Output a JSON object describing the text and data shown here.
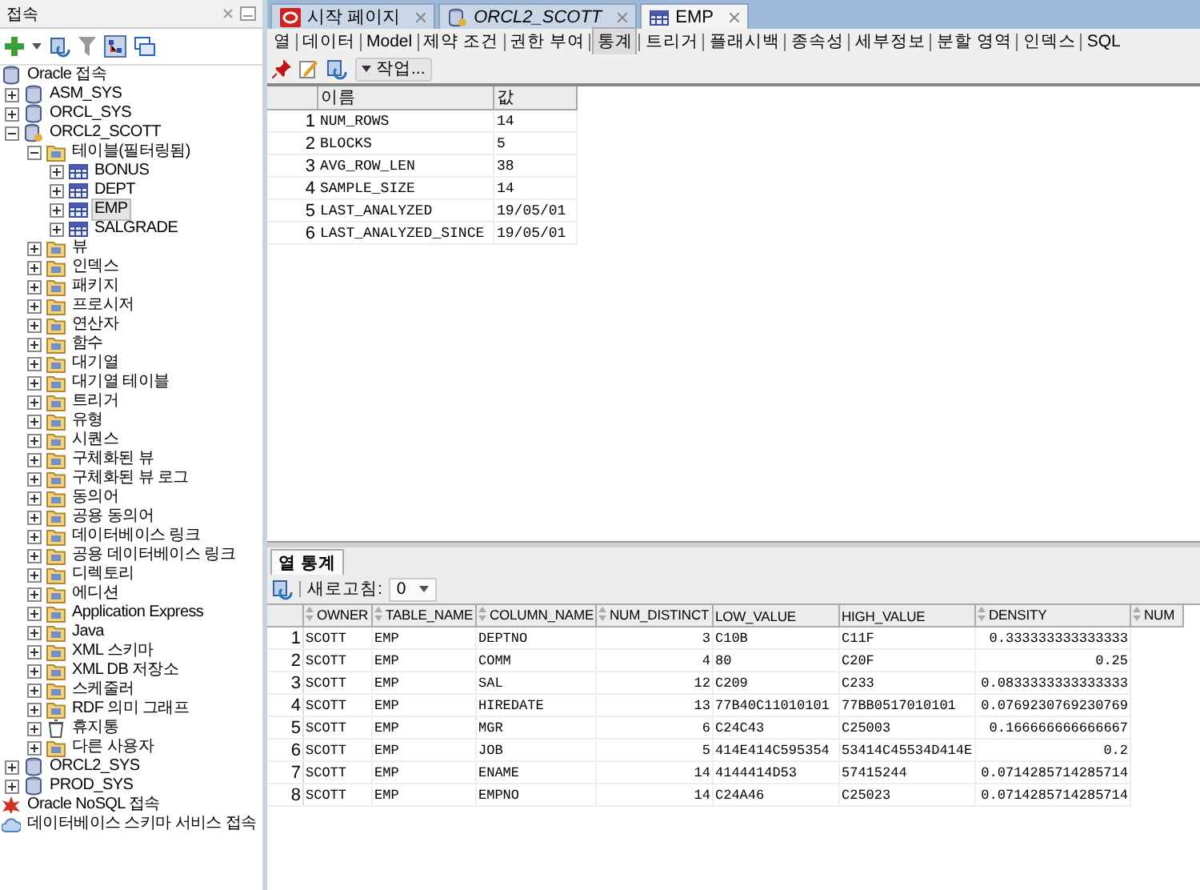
{
  "connections_panel": {
    "title": "접속",
    "tree": [
      {
        "label": "Oracle 접속",
        "kind": "connections",
        "selected": false,
        "children": [
          {
            "label": "ASM_SYS",
            "kind": "database",
            "expanded": false,
            "selected": false
          },
          {
            "label": "ORCL_SYS",
            "kind": "database",
            "expanded": false,
            "selected": false
          },
          {
            "label": "ORCL2_SCOTT",
            "kind": "database-user",
            "expanded": true,
            "selected": false,
            "children": [
              {
                "label": "테이블(필터링됨)",
                "kind": "folder",
                "expanded": true,
                "selected": false,
                "children": [
                  {
                    "label": "BONUS",
                    "kind": "table",
                    "expanded": false,
                    "selected": false
                  },
                  {
                    "label": "DEPT",
                    "kind": "table",
                    "expanded": false,
                    "selected": false
                  },
                  {
                    "label": "EMP",
                    "kind": "table",
                    "expanded": false,
                    "selected": true
                  },
                  {
                    "label": "SALGRADE",
                    "kind": "table",
                    "expanded": false,
                    "selected": false
                  }
                ]
              },
              {
                "label": "뷰",
                "kind": "folder",
                "expanded": false,
                "selected": false
              },
              {
                "label": "인덱스",
                "kind": "folder",
                "expanded": false,
                "selected": false
              },
              {
                "label": "패키지",
                "kind": "folder",
                "expanded": false,
                "selected": false
              },
              {
                "label": "프로시저",
                "kind": "folder",
                "expanded": false,
                "selected": false
              },
              {
                "label": "연산자",
                "kind": "folder",
                "expanded": false,
                "selected": false
              },
              {
                "label": "함수",
                "kind": "folder",
                "expanded": false,
                "selected": false
              },
              {
                "label": "대기열",
                "kind": "folder",
                "expanded": false,
                "selected": false
              },
              {
                "label": "대기열 테이블",
                "kind": "folder",
                "expanded": false,
                "selected": false
              },
              {
                "label": "트리거",
                "kind": "folder",
                "expanded": false,
                "selected": false
              },
              {
                "label": "유형",
                "kind": "folder",
                "expanded": false,
                "selected": false
              },
              {
                "label": "시퀀스",
                "kind": "folder",
                "expanded": false,
                "selected": false
              },
              {
                "label": "구체화된 뷰",
                "kind": "folder",
                "expanded": false,
                "selected": false
              },
              {
                "label": "구체화된 뷰 로그",
                "kind": "folder",
                "expanded": false,
                "selected": false
              },
              {
                "label": "동의어",
                "kind": "folder",
                "expanded": false,
                "selected": false
              },
              {
                "label": "공용 동의어",
                "kind": "folder",
                "expanded": false,
                "selected": false
              },
              {
                "label": "데이터베이스 링크",
                "kind": "folder",
                "expanded": false,
                "selected": false
              },
              {
                "label": "공용 데이터베이스 링크",
                "kind": "folder",
                "expanded": false,
                "selected": false
              },
              {
                "label": "디렉토리",
                "kind": "folder",
                "expanded": false,
                "selected": false
              },
              {
                "label": "에디션",
                "kind": "folder",
                "expanded": false,
                "selected": false
              },
              {
                "label": "Application Express",
                "kind": "folder",
                "expanded": false,
                "selected": false
              },
              {
                "label": "Java",
                "kind": "folder",
                "expanded": false,
                "selected": false
              },
              {
                "label": "XML 스키마",
                "kind": "folder",
                "expanded": false,
                "selected": false
              },
              {
                "label": "XML DB 저장소",
                "kind": "folder",
                "expanded": false,
                "selected": false
              },
              {
                "label": "스케줄러",
                "kind": "folder",
                "expanded": false,
                "selected": false
              },
              {
                "label": "RDF 의미 그래프",
                "kind": "folder",
                "expanded": false,
                "selected": false
              },
              {
                "label": "휴지통",
                "kind": "trash",
                "expanded": false,
                "selected": false
              },
              {
                "label": "다른 사용자",
                "kind": "folder",
                "expanded": false,
                "selected": false
              }
            ]
          },
          {
            "label": "ORCL2_SYS",
            "kind": "database",
            "expanded": false,
            "selected": false
          },
          {
            "label": "PROD_SYS",
            "kind": "database",
            "expanded": false,
            "selected": false
          }
        ]
      },
      {
        "label": "Oracle NoSQL 접속",
        "kind": "nosql",
        "selected": false
      },
      {
        "label": "데이터베이스 스키마 서비스 접속",
        "kind": "cloud",
        "selected": false
      }
    ]
  },
  "editor_tabs": [
    {
      "label": "시작 페이지",
      "kind": "start",
      "selected": false
    },
    {
      "label": "ORCL2_SCOTT",
      "kind": "connection",
      "selected": false
    },
    {
      "label": "EMP",
      "kind": "table",
      "selected": true
    }
  ],
  "sub_tabs": [
    {
      "label": "열",
      "selected": false
    },
    {
      "label": "데이터",
      "selected": false
    },
    {
      "label": "Model",
      "selected": false
    },
    {
      "label": "제약 조건",
      "selected": false
    },
    {
      "label": "권한 부여",
      "selected": false
    },
    {
      "label": "통계",
      "selected": true
    },
    {
      "label": "트리거",
      "selected": false
    },
    {
      "label": "플래시백",
      "selected": false
    },
    {
      "label": "종속성",
      "selected": false
    },
    {
      "label": "세부정보",
      "selected": false
    },
    {
      "label": "분할 영역",
      "selected": false
    },
    {
      "label": "인덱스",
      "selected": false
    },
    {
      "label": "SQL",
      "selected": false
    }
  ],
  "toolbar": {
    "actions_menu": "작업..."
  },
  "statistics_grid": {
    "columns": [
      "",
      "이름",
      "값"
    ],
    "rows": [
      [
        "1",
        "NUM_ROWS",
        "14"
      ],
      [
        "2",
        "BLOCKS",
        "5"
      ],
      [
        "3",
        "AVG_ROW_LEN",
        "38"
      ],
      [
        "4",
        "SAMPLE_SIZE",
        "14"
      ],
      [
        "5",
        "LAST_ANALYZED",
        "19/05/01"
      ],
      [
        "6",
        "LAST_ANALYZED_SINCE",
        "19/05/01"
      ]
    ]
  },
  "lower_panel": {
    "tab": {
      "label": "열 통계",
      "selected": true
    },
    "refresh_label": "새로고침:",
    "refresh_value": "0",
    "table": {
      "columns": [
        {
          "sortable": false
        },
        {
          "label": "OWNER",
          "sortable": true
        },
        {
          "label": "TABLE_NAME",
          "sortable": true
        },
        {
          "label": "COLUMN_NAME",
          "sortable": true
        },
        {
          "label": "NUM_DISTINCT",
          "sortable": true
        },
        {
          "label": "LOW_VALUE",
          "sortable": false
        },
        {
          "label": "HIGH_VALUE",
          "sortable": false
        },
        {
          "label": "DENSITY",
          "sortable": true
        },
        {
          "label": "NUM",
          "sortable": true
        }
      ],
      "rows": [
        [
          "1",
          "SCOTT",
          "EMP",
          "DEPTNO",
          "3",
          "C10B",
          "C11F",
          "0.333333333333333"
        ],
        [
          "2",
          "SCOTT",
          "EMP",
          "COMM",
          "4",
          "80",
          "C20F",
          "0.25"
        ],
        [
          "3",
          "SCOTT",
          "EMP",
          "SAL",
          "12",
          "C209",
          "C233",
          "0.0833333333333333"
        ],
        [
          "4",
          "SCOTT",
          "EMP",
          "HIREDATE",
          "13",
          "77B40C11010101",
          "77BB0517010101",
          "0.0769230769230769"
        ],
        [
          "5",
          "SCOTT",
          "EMP",
          "MGR",
          "6",
          "C24C43",
          "C25003",
          "0.166666666666667"
        ],
        [
          "6",
          "SCOTT",
          "EMP",
          "JOB",
          "5",
          "414E414C595354",
          "53414C45534D414E",
          "0.2"
        ],
        [
          "7",
          "SCOTT",
          "EMP",
          "ENAME",
          "14",
          "4144414D53",
          "57415244",
          "0.0714285714285714"
        ],
        [
          "8",
          "SCOTT",
          "EMP",
          "EMPNO",
          "14",
          "C24A46",
          "C25023",
          "0.0714285714285714"
        ]
      ]
    }
  }
}
